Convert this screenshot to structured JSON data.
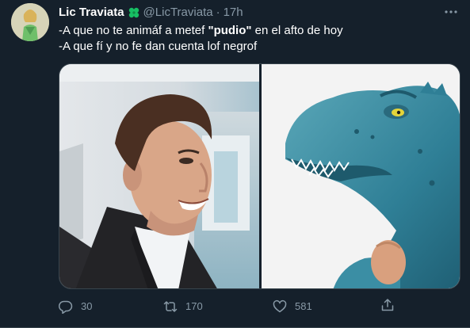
{
  "tweet": {
    "display_name": "Lic Traviata",
    "handle": "@LicTraviata",
    "separator": "·",
    "time": "17h",
    "text_line1_a": "-A que no te animáf a metef ",
    "text_line1_bold": "\"pudio\"",
    "text_line1_b": " en el afto de hoy",
    "text_line2": "-A que fí y no fe dan cuenta lof negrof"
  },
  "actions": {
    "reply_count": "30",
    "retweet_count": "170",
    "like_count": "581"
  },
  "icons": {
    "more": "more-horizontal-icon",
    "reply": "reply-icon",
    "retweet": "retweet-icon",
    "like": "heart-icon",
    "share": "share-icon",
    "badge": "four-leaf-clover-icon"
  },
  "colors": {
    "background": "#15202b",
    "secondary_text": "#8899a6",
    "border": "#38444d",
    "clover": "#17bf63"
  }
}
